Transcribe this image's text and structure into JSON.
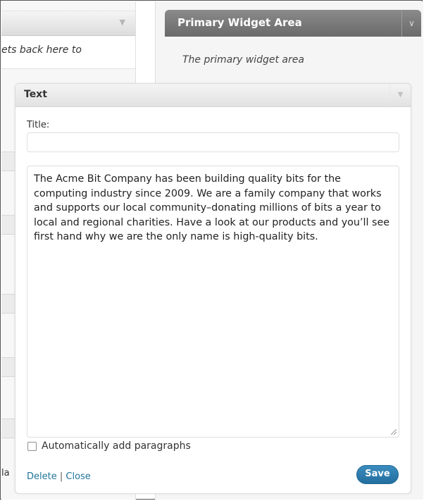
{
  "left_panel": {
    "description_fragment": "ets back here to",
    "cut_text": "la"
  },
  "sidebar": {
    "title": "Primary Widget Area",
    "description": "The primary widget area"
  },
  "widget": {
    "name": "Text",
    "title_label": "Title:",
    "title_value": "",
    "body": "The Acme Bit Company has been building quality bits for the computing industry since 2009. We are a family company that works and supports our local community–donating millions of bits a year to local and regional charities. Have a look at our products and you’ll see first hand why we are the only name is high-quality bits.",
    "auto_paragraphs_label": "Automatically add paragraphs",
    "auto_paragraphs_checked": false,
    "delete_label": "Delete",
    "separator": "|",
    "close_label": "Close",
    "save_label": "Save"
  },
  "icons": {
    "toggle": "triangle-down-icon",
    "resize": "resize-grip-icon"
  }
}
